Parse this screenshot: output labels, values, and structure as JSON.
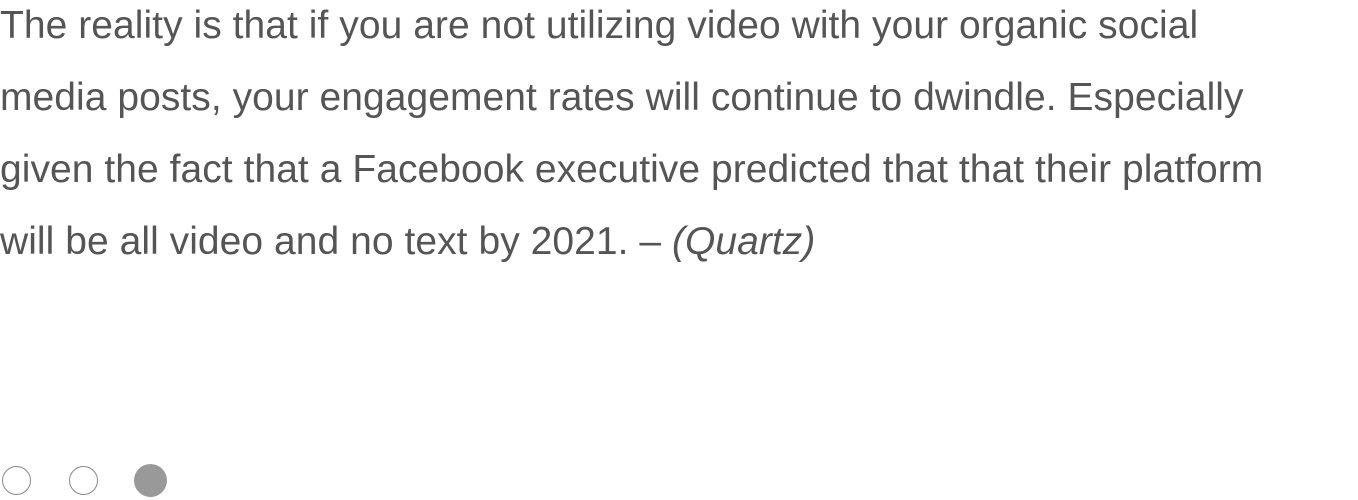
{
  "quote": {
    "lines": [
      "The reality is that if you are not utilizing video with your organic social",
      "media posts, your engagement rates will continue to dwindle. Especially",
      "given the fact that a Facebook executive predicted that that their platform",
      "will be all video and no text by 2021. – "
    ],
    "source": "(Quartz)"
  },
  "carousel": {
    "total_slides": 3,
    "active_slide": 3
  },
  "colors": {
    "text": "#555555",
    "dot_border": "#8a8a8a",
    "dot_active": "#999999",
    "background": "#ffffff"
  }
}
